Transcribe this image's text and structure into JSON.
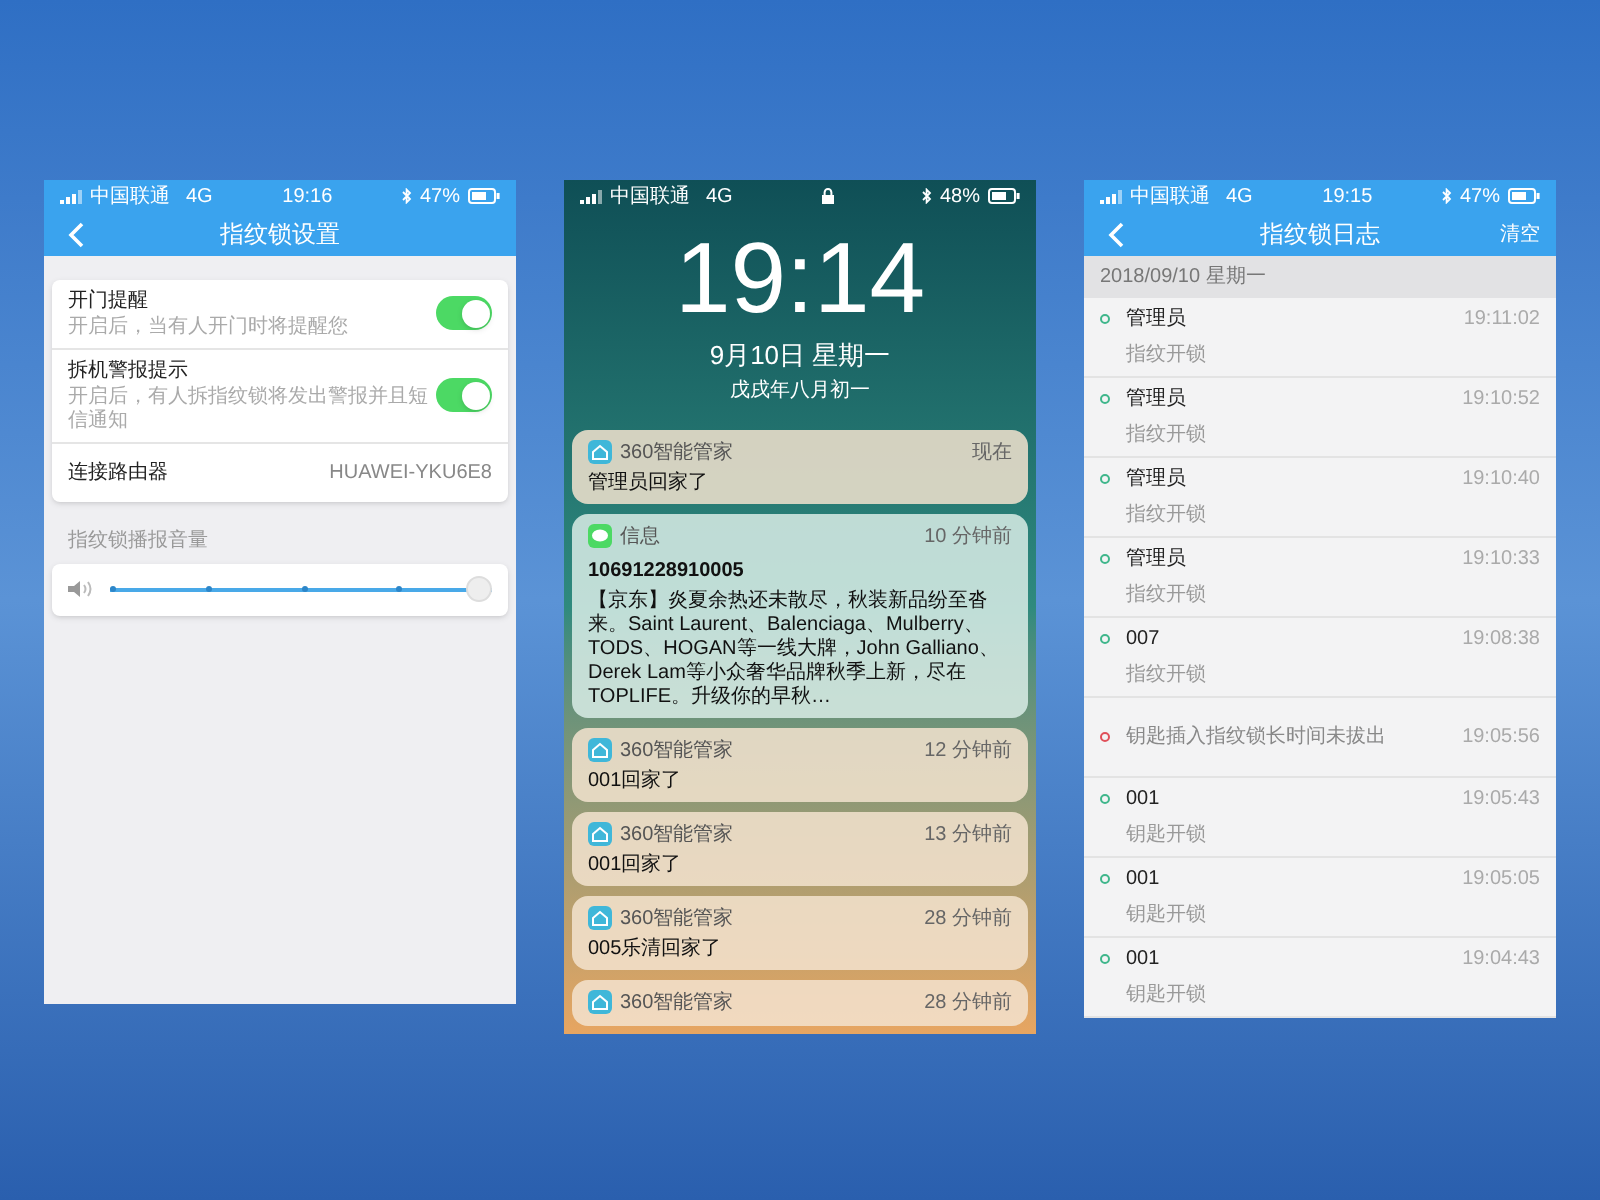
{
  "settings_screen": {
    "status_bar": {
      "carrier": "中国联通",
      "network": "4G",
      "time": "19:16",
      "battery": "47%"
    },
    "title": "指纹锁设置",
    "rows": [
      {
        "kind": "toggle",
        "label": "开门提醒",
        "description": "开启后，当有人开门时将提醒您",
        "on": true
      },
      {
        "kind": "toggle",
        "label": "拆机警报提示",
        "description": "开启后，有人拆指纹锁将发出警报并且短信通知",
        "on": true
      },
      {
        "kind": "value",
        "label": "连接路由器",
        "value": "HUAWEI-YKU6E8"
      }
    ],
    "volume_section": {
      "label": "指纹锁播报音量",
      "level": 1
    }
  },
  "lock_screen": {
    "status_bar": {
      "carrier": "中国联通",
      "network": "4G",
      "battery": "48%"
    },
    "clock": "19:14",
    "date": "9月10日 星期一",
    "lunar_date": "戊戌年八月初一",
    "notifications": [
      {
        "kind": "app",
        "app": "360智能管家",
        "time": "现在",
        "body": "管理员回家了"
      },
      {
        "kind": "message",
        "app": "信息",
        "time": "10 分钟前",
        "sender": "10691228910005",
        "body": "【京东】炎夏余热还未散尽，秋装新品纷至沓来。Saint Laurent、Balenciaga、Mulberry、TODS、HOGAN等一线大牌，John Galliano、Derek Lam等小众奢华品牌秋季上新，尽在TOPLIFE。升级你的早秋…"
      },
      {
        "kind": "app",
        "app": "360智能管家",
        "time": "12 分钟前",
        "body": "001回家了"
      },
      {
        "kind": "app",
        "app": "360智能管家",
        "time": "13 分钟前",
        "body": "001回家了"
      },
      {
        "kind": "app",
        "app": "360智能管家",
        "time": "28 分钟前",
        "body": "005乐清回家了"
      },
      {
        "kind": "app",
        "app": "360智能管家",
        "time": "28 分钟前"
      }
    ]
  },
  "log_screen": {
    "status_bar": {
      "carrier": "中国联通",
      "network": "4G",
      "time": "19:15",
      "battery": "47%"
    },
    "title": "指纹锁日志",
    "clear_button": "清空",
    "date_header": "2018/09/10 星期一",
    "entries": [
      {
        "kind": "entry",
        "name": "管理员",
        "time": "19:11:02",
        "detail": "指纹开锁",
        "color": "#3fb68b"
      },
      {
        "kind": "entry",
        "name": "管理员",
        "time": "19:10:52",
        "detail": "指纹开锁",
        "color": "#3fb68b"
      },
      {
        "kind": "entry",
        "name": "管理员",
        "time": "19:10:40",
        "detail": "指纹开锁",
        "color": "#3fb68b"
      },
      {
        "kind": "entry",
        "name": "管理员",
        "time": "19:10:33",
        "detail": "指纹开锁",
        "color": "#3fb68b"
      },
      {
        "kind": "entry",
        "name": "007",
        "time": "19:08:38",
        "detail": "指纹开锁",
        "color": "#3fb68b"
      },
      {
        "kind": "alert",
        "name": "钥匙插入指纹锁长时间未拔出",
        "time": "19:05:56",
        "color": "#e0505a"
      },
      {
        "kind": "entry",
        "name": "001",
        "time": "19:05:43",
        "detail": "钥匙开锁",
        "color": "#3fb68b"
      },
      {
        "kind": "entry",
        "name": "001",
        "time": "19:05:05",
        "detail": "钥匙开锁",
        "color": "#3fb68b"
      },
      {
        "kind": "entry",
        "name": "001",
        "time": "19:04:43",
        "detail": "钥匙开锁",
        "color": "#3fb68b"
      }
    ]
  }
}
